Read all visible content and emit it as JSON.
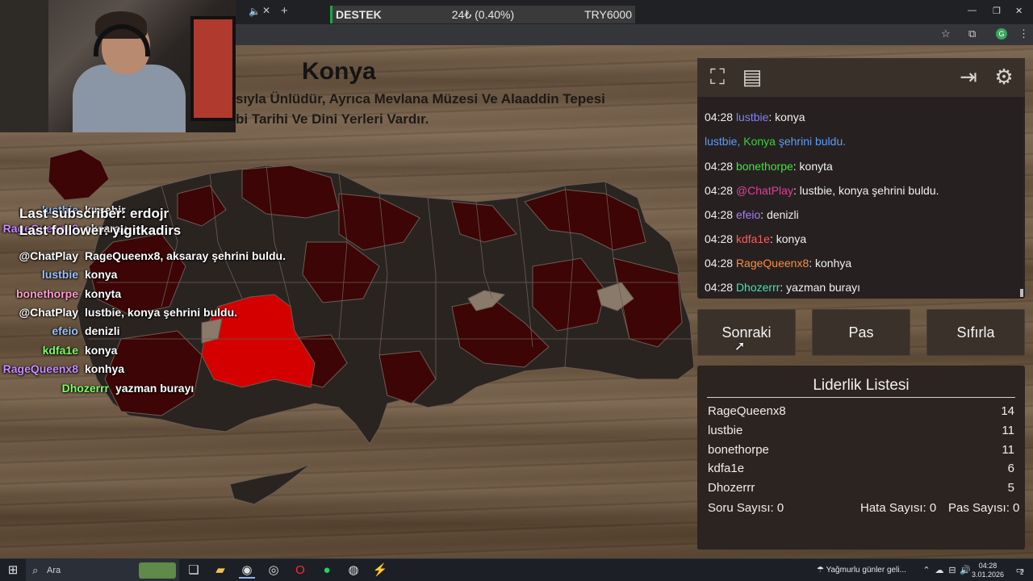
{
  "browser": {
    "tab_icons": [
      "speaker-icon",
      "close-icon",
      "plus-icon"
    ],
    "donation_bar": {
      "label": "DESTEK",
      "amount": "24₺ (0.40%)",
      "goal": "TRY6000"
    },
    "window_controls": [
      "minimize",
      "restore",
      "close"
    ]
  },
  "overlay": {
    "last_subscriber": "Last subscriber: erdojr",
    "last_follower": "Last follower: yigitkadirs"
  },
  "game": {
    "city_name": "Konya",
    "description_lines": [
      "sıyla Ünlüdür, Ayrıca Mevlana Müzesi Ve Alaaddin Tepesi",
      "bi Tarihi Ve Dini Yerleri Vardır."
    ],
    "highlight_color": "#d40000",
    "found_color": "#3d0505",
    "unfound_color": "#2a2421"
  },
  "left_chat": [
    {
      "user": "lustbie",
      "color": "#9ac2ff",
      "message": "kırşehir"
    },
    {
      "user": "RageQueenx8",
      "color": "#c98aff",
      "message": "aksaray"
    },
    {
      "user": "@ChatPlay",
      "color": "#ffffff",
      "message": "RageQueenx8, aksaray şehrini buldu."
    },
    {
      "user": "lustbie",
      "color": "#9ac2ff",
      "message": "konya"
    },
    {
      "user": "bonethorpe",
      "color": "#ff9acb",
      "message": "konyta"
    },
    {
      "user": "@ChatPlay",
      "color": "#ffffff",
      "message": "lustbie, konya şehrini buldu."
    },
    {
      "user": "efeio",
      "color": "#9ac2ff",
      "message": "denizli"
    },
    {
      "user": "kdfa1e",
      "color": "#7dff5e",
      "message": "konya"
    },
    {
      "user": "RageQueenx8",
      "color": "#c98aff",
      "message": "konhya"
    },
    {
      "user": "Dhozerrr",
      "color": "#7dff5e",
      "message": "yazman burayı"
    }
  ],
  "panel": {
    "toolbar_icons": [
      "fullscreen-icon",
      "notes-icon",
      "exit-icon",
      "settings-icon"
    ],
    "chat": [
      {
        "time": "04:28",
        "user": "lustbie",
        "user_color": "#7f7fff",
        "message": ": konya",
        "system": false
      },
      {
        "time": "",
        "user": "lustbie, ",
        "user_color": "#5b9bff",
        "city": "Konya",
        "city_color": "#3ccf3c",
        "message": " şehrini buldu.",
        "msg_color": "#5b9bff",
        "system": true
      },
      {
        "time": "04:28",
        "user": "bonethorpe",
        "user_color": "#3ee63e",
        "message": ": konyta",
        "system": false
      },
      {
        "time": "04:28",
        "user": "@ChatPlay",
        "user_color": "#e0409a",
        "message": ": lustbie, konya şehrini buldu.",
        "system": false
      },
      {
        "time": "04:28",
        "user": "efeio",
        "user_color": "#a77bff",
        "message": ": denizli",
        "system": false
      },
      {
        "time": "04:28",
        "user": "kdfa1e",
        "user_color": "#ff5b5b",
        "message": ": konya",
        "system": false
      },
      {
        "time": "04:28",
        "user": "RageQueenx8",
        "user_color": "#ff8a3d",
        "message": ": konhya",
        "system": false
      },
      {
        "time": "04:28",
        "user": "Dhozerrr",
        "user_color": "#3ee6b0",
        "message": ": yazman burayı",
        "system": false
      }
    ],
    "buttons": {
      "next": "Sonraki",
      "pass": "Pas",
      "reset": "Sıfırla"
    },
    "leaderboard": {
      "title": "Liderlik Listesi",
      "rows": [
        {
          "name": "RageQueenx8",
          "score": "14"
        },
        {
          "name": "lustbie",
          "score": "11"
        },
        {
          "name": "bonethorpe",
          "score": "11"
        },
        {
          "name": "kdfa1e",
          "score": "6"
        },
        {
          "name": "Dhozerrr",
          "score": "5"
        }
      ],
      "questions": "Soru Sayısı: 0",
      "errors": "Hata Sayısı: 0",
      "passes": "Pas Sayısı: 0"
    }
  },
  "taskbar": {
    "search_placeholder": "Ara",
    "apps": [
      "task-view-icon",
      "file-explorer-icon",
      "chrome-icon",
      "steam-icon",
      "opera-icon",
      "spotify-icon",
      "obs-icon",
      "app-icon"
    ],
    "weather": "Yağmurlu günler geli...",
    "time": "04:28",
    "date": "3.01.2026",
    "notification_count": "2"
  }
}
